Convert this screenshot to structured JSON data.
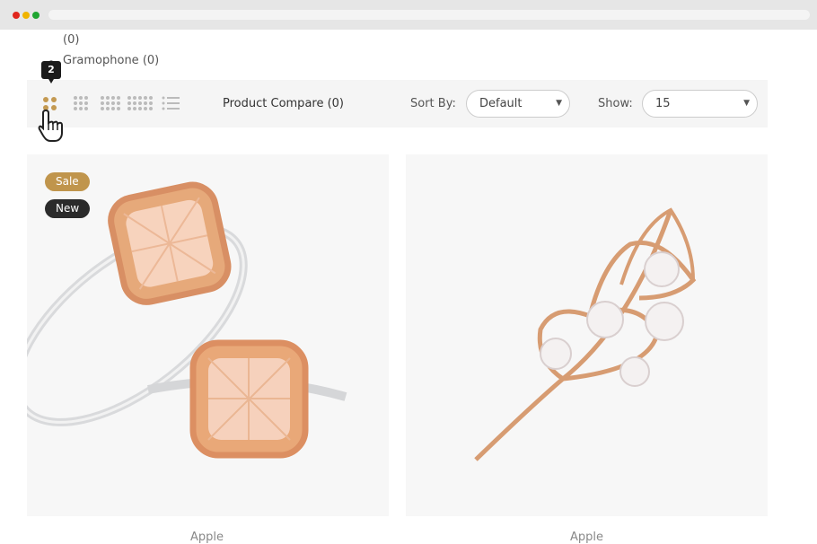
{
  "categories": [
    {
      "label": "(0)"
    },
    {
      "label": "Gramophone (0)"
    }
  ],
  "toolbar": {
    "tooltip": "2",
    "view_icons": [
      "grid-2-icon",
      "grid-3-icon",
      "grid-4-icon",
      "grid-5-icon",
      "list-icon"
    ],
    "active_view": "grid-2-icon",
    "product_compare": "Product Compare (0)",
    "sort_label": "Sort By:",
    "sort_value": "Default",
    "show_label": "Show:",
    "show_value": "15"
  },
  "products": [
    {
      "badges": [
        "Sale",
        "New"
      ],
      "image": "rose-gold-ring-pair",
      "brand": "Apple"
    },
    {
      "badges": [],
      "image": "pearl-leaf-brooch",
      "brand": "Apple"
    }
  ],
  "colors": {
    "accent": "#c0954c",
    "dark_badge": "#2b2b2b",
    "toolbar_bg": "#f5f5f5",
    "card_bg": "#f7f7f7"
  }
}
